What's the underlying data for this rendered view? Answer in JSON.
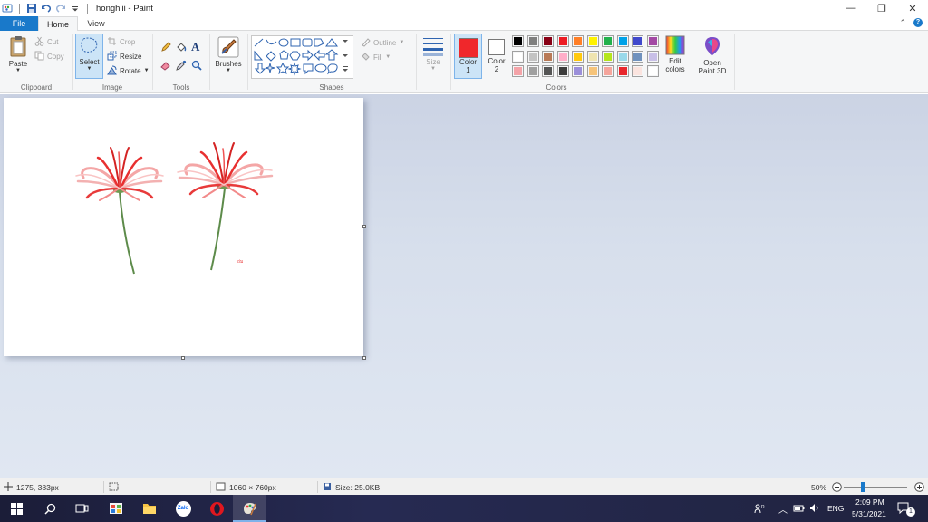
{
  "window": {
    "title": "honghiii - Paint",
    "minimize_glyph": "—",
    "restore_glyph": "❐",
    "close_glyph": "✕"
  },
  "tabs": {
    "file": "File",
    "home": "Home",
    "view": "View"
  },
  "ribbon": {
    "clipboard": {
      "group_label": "Clipboard",
      "paste": "Paste",
      "cut": "Cut",
      "copy": "Copy"
    },
    "image": {
      "group_label": "Image",
      "select": "Select",
      "crop": "Crop",
      "resize": "Resize",
      "rotate": "Rotate"
    },
    "tools": {
      "group_label": "Tools"
    },
    "brushes": {
      "label": "Brushes"
    },
    "shapes": {
      "group_label": "Shapes",
      "outline": "Outline",
      "fill": "Fill"
    },
    "size": {
      "label": "Size"
    },
    "colors": {
      "group_label": "Colors",
      "color1_label": "Color",
      "color1_num": "1",
      "color1_value": "#f0272b",
      "color2_label": "Color",
      "color2_num": "2",
      "color2_value": "#ffffff",
      "edit_colors_line1": "Edit",
      "edit_colors_line2": "colors",
      "open3d_line1": "Open",
      "open3d_line2": "Paint 3D",
      "palette_row1": [
        "#000000",
        "#7f7f7f",
        "#880015",
        "#ed1c24",
        "#ff7f27",
        "#fff200",
        "#22b14c",
        "#00a2e8",
        "#3f48cc",
        "#a349a4"
      ],
      "palette_row2": [
        "#ffffff",
        "#c3c3c3",
        "#b97a57",
        "#ffaec9",
        "#ffc90e",
        "#efe4b0",
        "#b5e61d",
        "#99d9ea",
        "#7092be",
        "#c8bfe7"
      ],
      "palette_row3": [
        "#f4a3a8",
        "#a0a0a0",
        "#555555",
        "#3c3c3c",
        "#9b8fd9",
        "#f6c47a",
        "#f5a59c",
        "#e8262c",
        "#fbe4df",
        "#ffffff"
      ]
    }
  },
  "canvas": {
    "signature_text": "ถ่ม"
  },
  "status": {
    "cursor_pos": "1275, 383px",
    "dimensions": "1060 × 760px",
    "size": "Size: 25.0KB",
    "zoom": "50%"
  },
  "taskbar": {
    "language": "ENG",
    "time": "2:09 PM",
    "date": "5/31/2021",
    "zalo_label": "Zalo",
    "notification_count": "1"
  }
}
